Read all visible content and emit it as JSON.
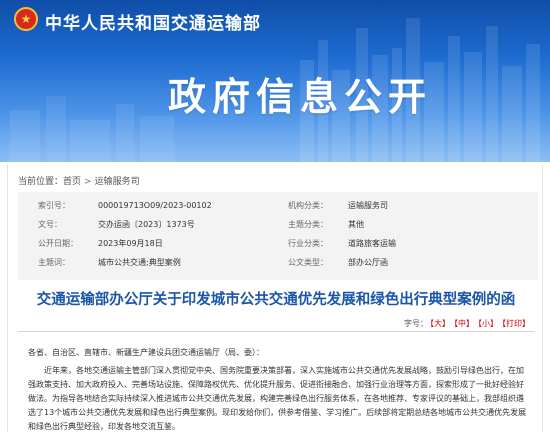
{
  "header": {
    "ministry_name": "中华人民共和国交通运输部",
    "banner_title": "政府信息公开"
  },
  "breadcrumb": {
    "label": "当前位置：",
    "items": [
      "首页",
      "运输服务司"
    ]
  },
  "meta": {
    "rows": [
      {
        "k1": "索引号：",
        "v1": "000019713O09/2023-00102",
        "k2": "机构分类：",
        "v2": "运输服务司"
      },
      {
        "k1": "文号：",
        "v1": "交办运函〔2023〕1373号",
        "k2": "主题分类：",
        "v2": "其他"
      },
      {
        "k1": "公开日期：",
        "v1": "2023年09月18日",
        "k2": "行业分类：",
        "v2": "道路旅客运输"
      },
      {
        "k1": "主题词：",
        "v1": "城市公共交通;典型案例",
        "k2": "公文类型：",
        "v2": "部办公厅函"
      }
    ]
  },
  "document": {
    "title": "交通运输部办公厅关于印发城市公共交通优先发展和绿色出行典型案例的函",
    "font_size_label": "字号：",
    "font_sizes": [
      "【大】",
      "【中】",
      "【小】"
    ],
    "print_label": "【打印】",
    "addressee": "各省、自治区、直辖市、新疆生产建设兵团交通运输厅（局、委）：",
    "body": "近年来，各地交通运输主管部门深入贯彻党中央、国务院重要决策部署，深入实施城市公共交通优先发展战略，鼓励引导绿色出行，在加强政策支持、加大政府投入、完善场站设施、保障路权优先、优化提升服务、促进衔接融合、加强行业治理等方面，探索形成了一批好经验好做法。为指导各地结合实际持续深入推进城市公共交通优先发展，构建完善绿色出行服务体系，在各地推荐、专家评议的基础上，我部组织遴选了13个城市公共交通优先发展和绿色出行典型案例。现印发给你们，供参考借鉴、学习推广。后续部将定期总结各地城市公共交通优先发展和绿色出行典型经验，印发各地交流互鉴。"
  },
  "colors": {
    "banner_top": "#0f4ea8",
    "title_blue": "#1b55a9",
    "accent_red": "#c00000"
  }
}
